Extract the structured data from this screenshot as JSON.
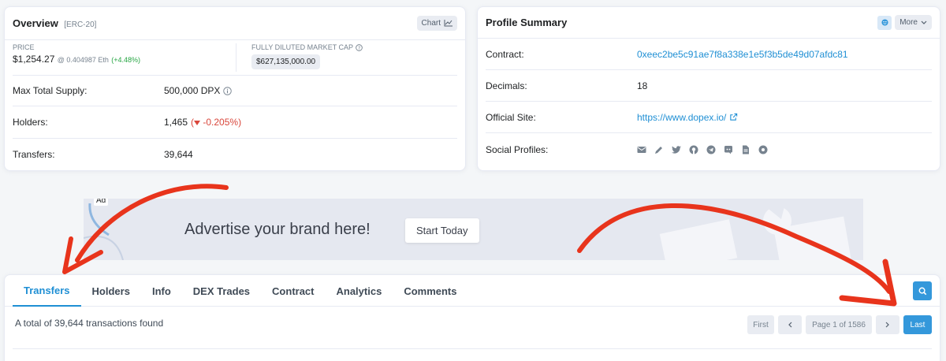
{
  "overview": {
    "title": "Overview",
    "token_type": "[ERC-20]",
    "chart_btn": "Chart",
    "price_label": "PRICE",
    "price_value": "$1,254.27",
    "price_eth": "@ 0.404987 Eth",
    "price_change": "(+4.48%)",
    "mcap_label": "FULLY DILUTED MARKET CAP",
    "mcap_value": "$627,135,000.00",
    "rows": [
      {
        "label": "Max Total Supply:",
        "value": "500,000 DPX"
      },
      {
        "label": "Holders:",
        "value": "1,465",
        "change": "-0.205%"
      },
      {
        "label": "Transfers:",
        "value": "39,644"
      }
    ]
  },
  "profile": {
    "title": "Profile Summary",
    "more_btn": "More",
    "rows": [
      {
        "label": "Contract:",
        "value": "0xeec2be5c91ae7f8a338e1e5f3b5de49d07afdc81"
      },
      {
        "label": "Decimals:",
        "value": "18"
      },
      {
        "label": "Official Site:",
        "value": "https://www.dopex.io/"
      },
      {
        "label": "Social Profiles:"
      }
    ],
    "social_icons": [
      "email-icon",
      "pen-icon",
      "twitter-icon",
      "github-icon",
      "telegram-icon",
      "discord-icon",
      "document-icon",
      "chrome-icon"
    ]
  },
  "ad": {
    "badge": "Ad",
    "text": "Advertise your brand here!",
    "button": "Start Today"
  },
  "transfers": {
    "tabs": [
      "Transfers",
      "Holders",
      "Info",
      "DEX Trades",
      "Contract",
      "Analytics",
      "Comments"
    ],
    "active_tab": "Transfers",
    "summary": "A total of 39,644 transactions found",
    "pagination": {
      "first": "First",
      "page": "Page 1 of 1586",
      "last": "Last"
    }
  },
  "colors": {
    "accent": "#3498db",
    "link": "#1f8fd4",
    "negative": "#d9463b",
    "positive": "#27a644",
    "annotation": "#e8341c"
  }
}
